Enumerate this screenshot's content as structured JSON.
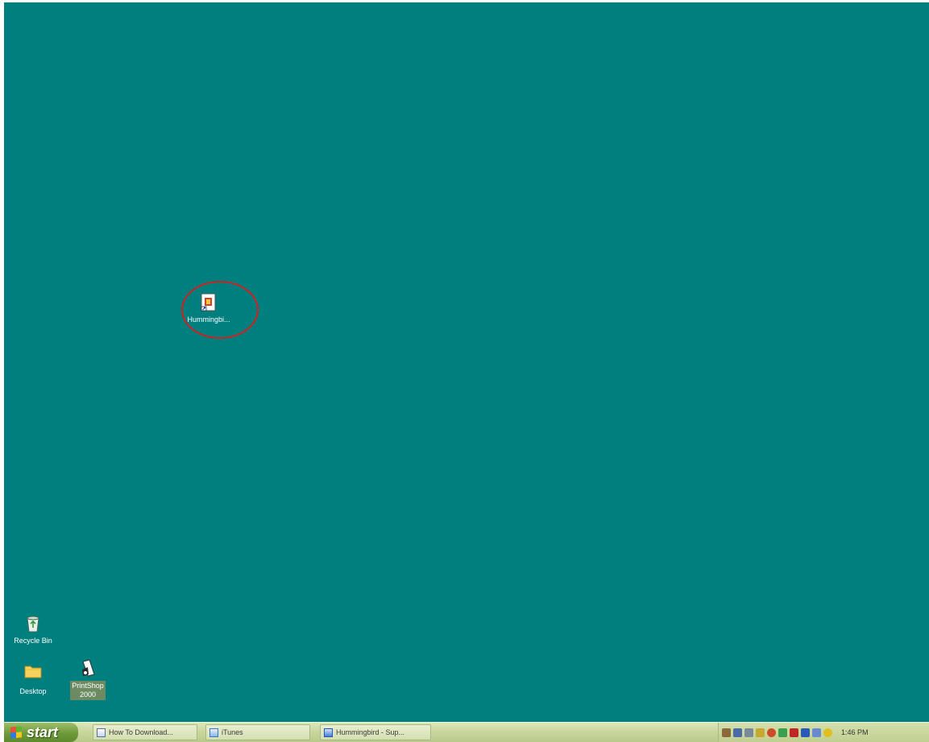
{
  "desktop": {
    "background_color": "#007f7f",
    "annotation_color": "#d02020",
    "icons": {
      "hummingbird": {
        "label": "Hummingbi...",
        "icon": "shortcut-document-icon"
      },
      "recycle_bin": {
        "label": "Recycle Bin",
        "icon": "recycle-bin-icon"
      },
      "desktop_folder": {
        "label": "Desktop",
        "icon": "folder-icon"
      },
      "printshop": {
        "label": "PrintShop 2000",
        "icon": "printshop-app-icon"
      }
    }
  },
  "taskbar": {
    "start_label": "start",
    "tasks": [
      {
        "label": "How To Download...",
        "icon": "document-icon"
      },
      {
        "label": "iTunes",
        "icon": "itunes-icon"
      },
      {
        "label": "Hummingbird - Sup...",
        "icon": "browser-icon"
      }
    ],
    "tray": {
      "icons": [
        "pen-icon",
        "monitor-icon",
        "speaker-icon",
        "network-icon",
        "security-icon",
        "messenger-icon",
        "shield-icon",
        "display-icon",
        "update-icon",
        "bulb-icon"
      ],
      "clock": "1:46 PM"
    }
  }
}
